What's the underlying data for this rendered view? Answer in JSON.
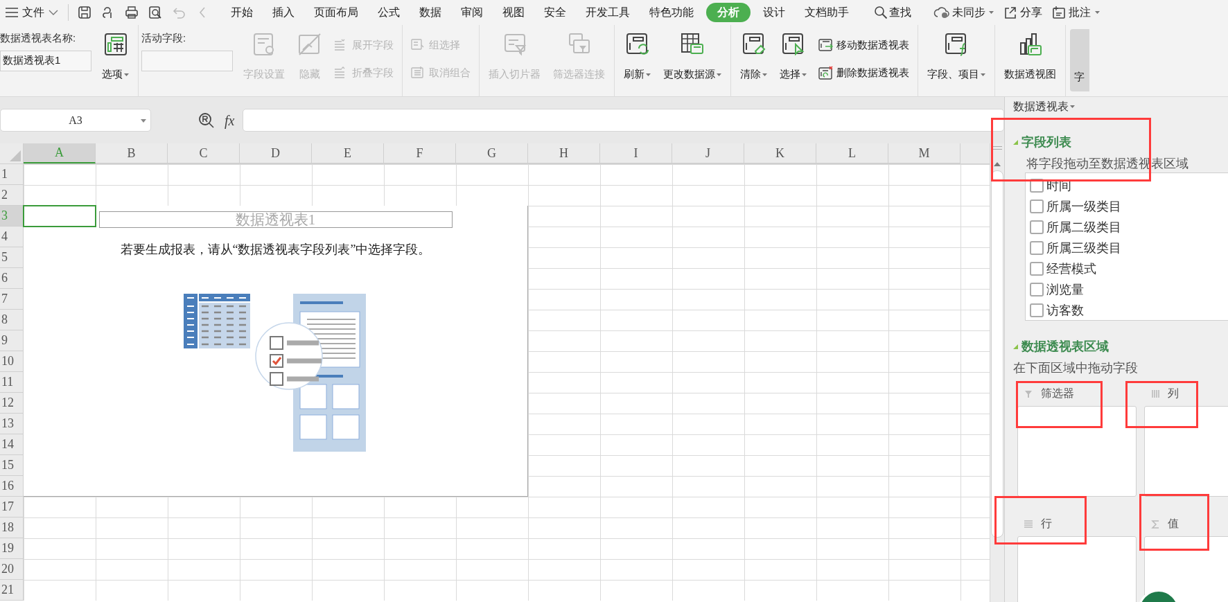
{
  "menu_bar": {
    "file_menu": "文件",
    "tabs": [
      {
        "label": "开始",
        "selected": false
      },
      {
        "label": "插入",
        "selected": false
      },
      {
        "label": "页面布局",
        "selected": false
      },
      {
        "label": "公式",
        "selected": false
      },
      {
        "label": "数据",
        "selected": false
      },
      {
        "label": "审阅",
        "selected": false
      },
      {
        "label": "视图",
        "selected": false
      },
      {
        "label": "安全",
        "selected": false
      },
      {
        "label": "开发工具",
        "selected": false
      },
      {
        "label": "特色功能",
        "selected": false
      },
      {
        "label": "分析",
        "selected": true
      },
      {
        "label": "设计",
        "selected": false
      },
      {
        "label": "文档助手",
        "selected": false
      }
    ],
    "search": "查找",
    "sync": "未同步",
    "share": "分享",
    "comment": "批注"
  },
  "ribbon": {
    "groups": [
      {
        "items": [
          {
            "kind": "field",
            "label": "数据透视表名称:",
            "value": "数据透视表1"
          },
          {
            "kind": "large",
            "label": "选项",
            "disabled": false,
            "dropdown": true
          }
        ]
      },
      {
        "items": [
          {
            "kind": "field",
            "label": "活动字段:"
          },
          {
            "kind": "large",
            "label": "字段设置",
            "disabled": true,
            "dropdown": false
          },
          {
            "kind": "large",
            "label": "隐藏",
            "disabled": true,
            "dropdown": false
          },
          {
            "kind": "small",
            "label": "展开字段",
            "disabled": true,
            "dropdown": false
          },
          {
            "kind": "small",
            "label": "折叠字段",
            "disabled": true,
            "dropdown": false
          }
        ]
      },
      {
        "items": [
          {
            "kind": "small",
            "label": "组选择",
            "disabled": true,
            "dropdown": false
          },
          {
            "kind": "small",
            "label": "取消组合",
            "disabled": true,
            "dropdown": false
          }
        ]
      },
      {
        "items": [
          {
            "kind": "large",
            "label": "插入切片器",
            "disabled": true,
            "dropdown": false
          },
          {
            "kind": "large",
            "label": "筛选器连接",
            "disabled": true,
            "dropdown": false
          }
        ]
      },
      {
        "items": [
          {
            "kind": "large",
            "label": "刷新",
            "disabled": false,
            "dropdown": true
          },
          {
            "kind": "large",
            "label": "更改数据源",
            "disabled": false,
            "dropdown": true
          }
        ]
      },
      {
        "items": [
          {
            "kind": "large",
            "label": "清除",
            "disabled": false,
            "dropdown": true
          },
          {
            "kind": "large",
            "label": "选择",
            "disabled": false,
            "dropdown": true
          },
          {
            "kind": "small",
            "label": "移动数据透视表",
            "disabled": false,
            "dropdown": false
          },
          {
            "kind": "small",
            "label": "删除数据透视表",
            "disabled": false,
            "dropdown": false
          }
        ]
      },
      {
        "items": [
          {
            "kind": "large",
            "label": "字段、项目",
            "disabled": false,
            "dropdown": true
          }
        ]
      },
      {
        "items": [
          {
            "kind": "large",
            "label": "数据透视图",
            "disabled": false,
            "dropdown": false
          }
        ]
      }
    ],
    "cut_button": {
      "label": "字",
      "pressed": true
    }
  },
  "formula_bar": {
    "name_box": "A3",
    "fx": "fx"
  },
  "sheet": {
    "columns": [
      {
        "label": "A",
        "selected": true
      },
      {
        "label": "B",
        "selected": false
      },
      {
        "label": "C",
        "selected": false
      },
      {
        "label": "D",
        "selected": false
      },
      {
        "label": "E",
        "selected": false
      },
      {
        "label": "F",
        "selected": false
      },
      {
        "label": "G",
        "selected": false
      },
      {
        "label": "H",
        "selected": false
      },
      {
        "label": "I",
        "selected": false
      },
      {
        "label": "J",
        "selected": false
      },
      {
        "label": "K",
        "selected": false
      },
      {
        "label": "L",
        "selected": false
      },
      {
        "label": "M",
        "selected": false
      }
    ],
    "rows": [
      {
        "label": "1",
        "selected": false
      },
      {
        "label": "2",
        "selected": false
      },
      {
        "label": "3",
        "selected": true
      },
      {
        "label": "4",
        "selected": false
      },
      {
        "label": "5",
        "selected": false
      },
      {
        "label": "6",
        "selected": false
      },
      {
        "label": "7",
        "selected": false
      },
      {
        "label": "8",
        "selected": false
      },
      {
        "label": "9",
        "selected": false
      },
      {
        "label": "10",
        "selected": false
      },
      {
        "label": "11",
        "selected": false
      },
      {
        "label": "12",
        "selected": false
      },
      {
        "label": "13",
        "selected": false
      },
      {
        "label": "14",
        "selected": false
      },
      {
        "label": "15",
        "selected": false
      },
      {
        "label": "16",
        "selected": false
      },
      {
        "label": "17",
        "selected": false
      },
      {
        "label": "18",
        "selected": false
      },
      {
        "label": "19",
        "selected": false
      },
      {
        "label": "20",
        "selected": false
      },
      {
        "label": "21",
        "selected": false
      }
    ],
    "pivot_placeholder": {
      "title": "数据透视表1",
      "message": "若要生成报表，请从“数据透视表字段列表”中选择字段。"
    }
  },
  "pivot_panel": {
    "header": "数据透视表",
    "field_list": {
      "title": "字段列表",
      "hint": "将字段拖动至数据透视表区域",
      "fields": [
        {
          "label": "时间",
          "checked": false
        },
        {
          "label": "所属一级类目",
          "checked": false
        },
        {
          "label": "所属二级类目",
          "checked": false
        },
        {
          "label": "所属三级类目",
          "checked": false
        },
        {
          "label": "经营模式",
          "checked": false
        },
        {
          "label": "浏览量",
          "checked": false
        },
        {
          "label": "访客数",
          "checked": false
        }
      ]
    },
    "areas": {
      "title": "数据透视表区域",
      "hint": "在下面区域中拖动字段",
      "zones": [
        {
          "kind": "filter",
          "label": "筛选器"
        },
        {
          "kind": "column",
          "label": "列"
        },
        {
          "kind": "row",
          "label": "行"
        },
        {
          "kind": "value",
          "label": "值"
        }
      ]
    }
  }
}
